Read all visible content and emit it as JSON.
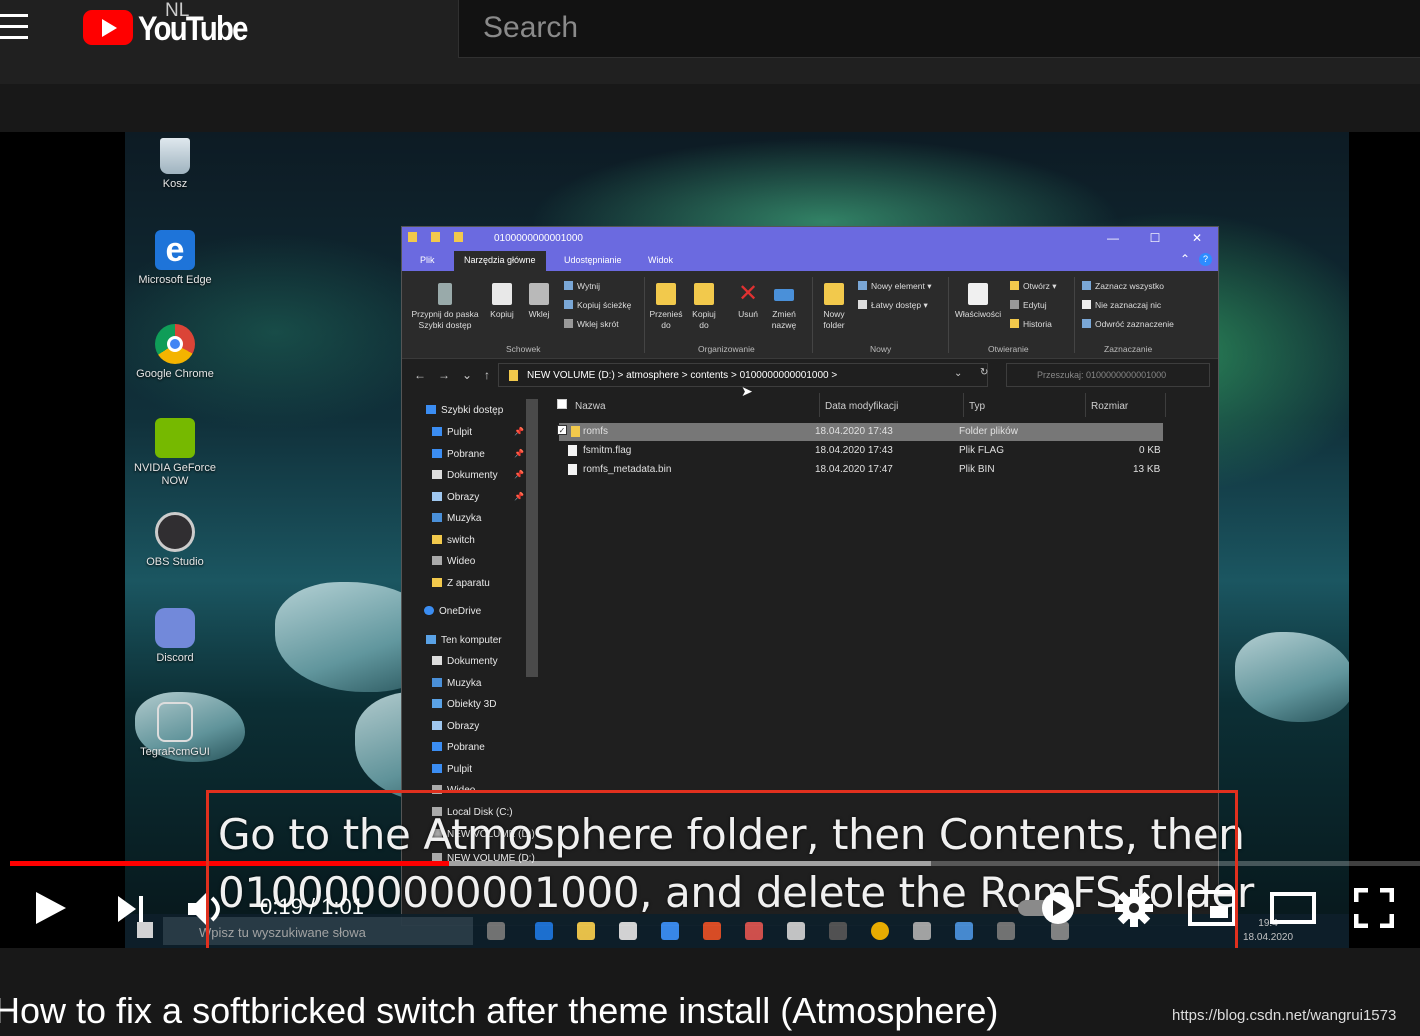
{
  "masthead": {
    "logo_text": "YouTube",
    "region": "NL",
    "search_placeholder": "Search"
  },
  "video": {
    "desktop_icons": [
      {
        "label": "Kosz"
      },
      {
        "label": "Microsoft Edge"
      },
      {
        "label": "Google Chrome"
      },
      {
        "label": "NVIDIA GeForce NOW"
      },
      {
        "label": "OBS Studio"
      },
      {
        "label": "Discord"
      },
      {
        "label": "TegraRcmGUI"
      }
    ],
    "explorer": {
      "title": "0100000000001000",
      "tabs": [
        "Plik",
        "Narzędzia główne",
        "Udostępnianie",
        "Widok"
      ],
      "ribbon": {
        "pin": "Przypnij do paska Szybki dostęp",
        "copy": "Kopiuj",
        "paste": "Wklej",
        "cut": "Wytnij",
        "copy_path": "Kopiuj ścieżkę",
        "paste_shortcut": "Wklej skrót",
        "move_to": "Przenieś do",
        "copy_to": "Kopiuj do",
        "delete": "Usuń",
        "rename": "Zmień nazwę",
        "new_folder": "Nowy folder",
        "new_item": "Nowy element",
        "easy_access": "Łatwy dostęp",
        "properties": "Właściwości",
        "open": "Otwórz",
        "edit": "Edytuj",
        "history": "Historia",
        "select_all": "Zaznacz wszystko",
        "select_none": "Nie zaznaczaj nic",
        "invert": "Odwróć zaznaczenie",
        "groups": [
          "Schowek",
          "Organizowanie",
          "Nowy",
          "Otwieranie",
          "Zaznaczanie"
        ]
      },
      "address": "NEW VOLUME (D:)  >  atmosphere  >  contents  >  0100000000001000  >",
      "search_placeholder": "Przeszukaj: 0100000000001000",
      "sidebar": [
        "Szybki dostęp",
        "Pulpit",
        "Pobrane",
        "Dokumenty",
        "Obrazy",
        "Muzyka",
        "switch",
        "Wideo",
        "Z aparatu",
        "OneDrive",
        "Ten komputer",
        "Dokumenty",
        "Muzyka",
        "Obiekty 3D",
        "Obrazy",
        "Pobrane",
        "Pulpit",
        "Wideo",
        "Local Disk (C:)",
        "NEW VOLUME (D:)",
        "NEW VOLUME (D:)"
      ],
      "columns": [
        "Nazwa",
        "Data modyfikacji",
        "Typ",
        "Rozmiar"
      ],
      "files": [
        {
          "name": "romfs",
          "date": "18.04.2020 17:43",
          "type": "Folder plików",
          "size": ""
        },
        {
          "name": "fsmitm.flag",
          "date": "18.04.2020 17:43",
          "type": "Plik FLAG",
          "size": "0 KB"
        },
        {
          "name": "romfs_metadata.bin",
          "date": "18.04.2020 17:47",
          "type": "Plik BIN",
          "size": "13 KB"
        }
      ]
    },
    "taskbar": {
      "search_placeholder": "Wpisz tu wyszukiwane słowa",
      "time": "19:4",
      "date": "18.04.2020"
    }
  },
  "captions": {
    "line1": "Go to the Atmosphere folder, then Contents, then",
    "line2": "0100000000001000, and delete the RomFS folder"
  },
  "player": {
    "current_time": "0:19",
    "duration": "1:01",
    "time_label": "0:19 / 1:01",
    "progress_fraction": 0.3115,
    "buffered_fraction": 0.653
  },
  "title": "How to fix a softbricked switch after theme install (Atmosphere)",
  "watermark": "https://blog.csdn.net/wangrui1573",
  "colors": {
    "brand_red": "#ff0000",
    "highlight_box": "#e0301e",
    "explorer_titlebar": "#6b6ae0"
  }
}
